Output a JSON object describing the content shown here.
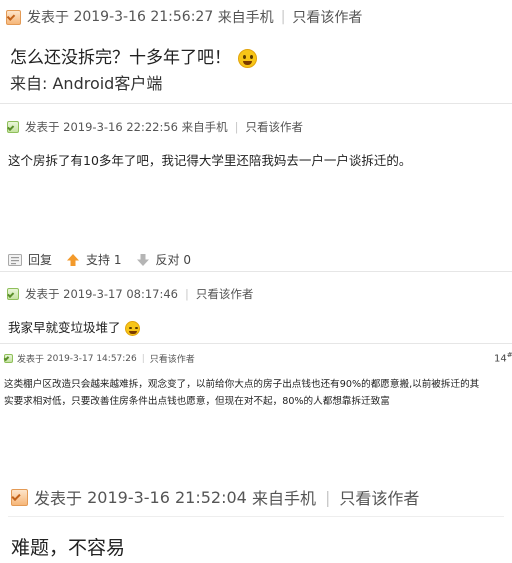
{
  "posts": [
    {
      "posted_prefix": "发表于",
      "datetime": "2019-3-16 21:56:27",
      "source": "来自手机",
      "only_author": "只看该作者",
      "text": "怎么还没拆完？十多年了吧！",
      "signature": "来自: Android客户端"
    },
    {
      "posted_prefix": "发表于",
      "datetime": "2019-3-16 22:22:56",
      "source": "来自手机",
      "only_author": "只看该作者",
      "text": "这个房拆了有10多年了吧，我记得大学里还陪我妈去一户一户谈拆迁的。",
      "actions": {
        "reply": "回复",
        "support": "支持",
        "support_count": "1",
        "oppose": "反对",
        "oppose_count": "0"
      }
    },
    {
      "posted_prefix": "发表于",
      "datetime": "2019-3-17 08:17:46",
      "only_author": "只看该作者",
      "text": "我家早就变垃圾堆了"
    },
    {
      "posted_prefix": "发表于",
      "datetime": "2019-3-17 14:57:26",
      "only_author": "只看该作者",
      "floor_number": "14",
      "floor_suffix": "#",
      "text_line1": "这类棚户区改造只会越来越难拆，观念变了，以前给你大点的房子出点钱也还有90%的都愿意搬,以前被拆迁的其",
      "text_line2": "实要求相对低，只要改善住房条件出点钱也愿意，但现在对不起，80%的人都想靠拆迁致富"
    },
    {
      "posted_prefix": "发表于",
      "datetime": "2019-3-16 21:52:04",
      "source": "来自手机",
      "only_author": "只看该作者",
      "text": "难题，不容易"
    }
  ]
}
